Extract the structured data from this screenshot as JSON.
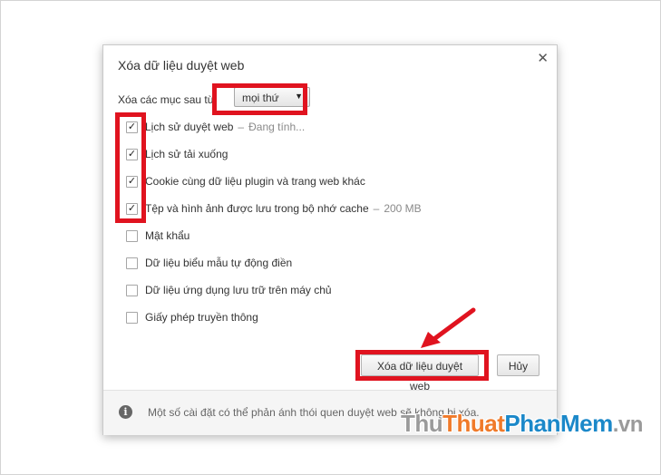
{
  "dialog": {
    "title": "Xóa dữ liệu duyệt web",
    "close_icon": "close-icon",
    "range": {
      "label": "Xóa các mục sau từ:",
      "selected": "mọi thứ"
    },
    "items": [
      {
        "label": "Lịch sử duyệt web",
        "meta": "Đang tính...",
        "checked": true
      },
      {
        "label": "Lịch sử tải xuống",
        "meta": "",
        "checked": true
      },
      {
        "label": "Cookie cùng dữ liệu plugin và trang web khác",
        "meta": "",
        "checked": true
      },
      {
        "label": "Tệp và hình ảnh được lưu trong bộ nhớ cache",
        "meta": "200 MB",
        "checked": true
      },
      {
        "label": "Mật khẩu",
        "meta": "",
        "checked": false
      },
      {
        "label": "Dữ liệu biểu mẫu tự động điền",
        "meta": "",
        "checked": false
      },
      {
        "label": "Dữ liệu ứng dụng lưu trữ trên máy chủ",
        "meta": "",
        "checked": false
      },
      {
        "label": "Giấy phép truyền thông",
        "meta": "",
        "checked": false
      }
    ],
    "buttons": {
      "clear": "Xóa dữ liệu duyệt web",
      "cancel": "Hủy"
    },
    "footer": {
      "icon": "info-icon",
      "text": "Một số cài đặt có thể phản ánh thói quen duyệt web sẽ không bị xóa."
    }
  },
  "watermark": {
    "part1": "Thu",
    "part2": "Thuat",
    "part3": "PhanMem",
    "part4": ".vn"
  },
  "colors": {
    "highlight": "#e0131f",
    "watermark_orange": "#f07a2a",
    "watermark_blue": "#1b88c9"
  }
}
